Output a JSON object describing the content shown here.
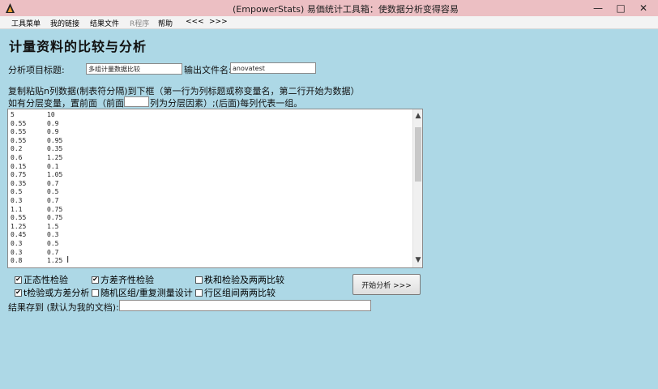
{
  "window": {
    "title": "(EmpowerStats) 易価统计工具箱：使数据分析变得容易",
    "controls": {
      "minimize": "—",
      "maximize": "□",
      "close": "✕"
    }
  },
  "menu": {
    "items": [
      "工具菜单",
      "我的链接",
      "结果文件",
      "R程序",
      "帮助",
      "<<<",
      ">>>"
    ]
  },
  "page": {
    "title": "计量资料的比较与分析"
  },
  "form": {
    "project_title_label": "分析项目标题:",
    "project_title_value": "多组计量数据比较",
    "output_file_label": "输出文件名:",
    "output_file_value": "anovatest",
    "instruction_line1": "复制粘贴n列数据(制表符分隔)到下框（第一行为列标题或称变量名，第二行开始为数据）",
    "instruction_line2_before": "如有分层变量，置前面（前面",
    "strata_value": "",
    "instruction_line2_after": "列为分层因素）;(后面)每列代表一组。",
    "data_rows": [
      [
        "5",
        "10"
      ],
      [
        "0.55",
        "0.9"
      ],
      [
        "0.55",
        "0.9"
      ],
      [
        "0.55",
        "0.95"
      ],
      [
        "0.2",
        "0.35"
      ],
      [
        "0.6",
        "1.25"
      ],
      [
        "0.15",
        "0.1"
      ],
      [
        "0.75",
        "1.05"
      ],
      [
        "0.35",
        "0.7"
      ],
      [
        "0.5",
        "0.5"
      ],
      [
        "0.3",
        "0.7"
      ],
      [
        "1.1",
        "0.75"
      ],
      [
        "0.55",
        "0.75"
      ],
      [
        "1.25",
        "1.5"
      ],
      [
        "0.45",
        "0.3"
      ],
      [
        "0.3",
        "0.5"
      ],
      [
        "0.3",
        "0.7"
      ],
      [
        "0.8",
        "1.25"
      ]
    ],
    "checkboxes": [
      {
        "label": "正态性检验",
        "checked": true
      },
      {
        "label": "方差齐性检验",
        "checked": true
      },
      {
        "label": "秩和检验及两两比较",
        "checked": false
      },
      {
        "label": "t检验或方差分析",
        "checked": true
      },
      {
        "label": "随机区组/重复测量设计",
        "checked": false
      },
      {
        "label": "行区组间两两比较",
        "checked": false
      }
    ],
    "start_button": "开始分析 >>>",
    "save_label": "结果存到 (默认为我的文档):",
    "save_value": ""
  }
}
